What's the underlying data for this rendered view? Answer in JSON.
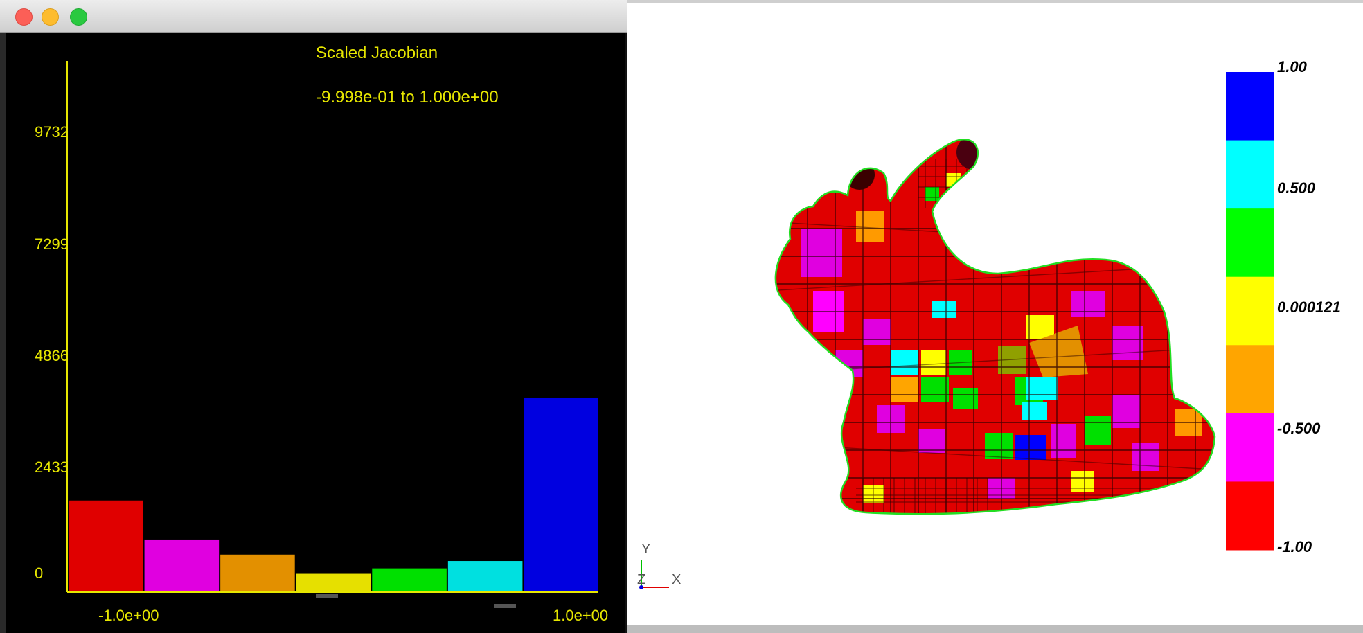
{
  "histogram_window": {
    "title_buttons": [
      "close",
      "minimize",
      "maximize"
    ]
  },
  "chart_data": {
    "type": "bar",
    "title": "Scaled Jacobian",
    "subtitle": "-9.998e-01 to 1.000e+00",
    "y_ticks": [
      "9732",
      "7299",
      "4866",
      "2433",
      "0"
    ],
    "x_ticks": [
      "-1.0e+00",
      "1.0e+00"
    ],
    "ylim": [
      0,
      11600
    ],
    "values": [
      2000,
      1150,
      820,
      400,
      520,
      680,
      4250
    ],
    "colors": [
      "#e00000",
      "#e000e0",
      "#e39000",
      "#e6e000",
      "#00e000",
      "#00e0e0",
      "#0000e0"
    ],
    "axis_color": "#e6e600"
  },
  "color_bar": {
    "labels": [
      "1.00",
      "0.500",
      "0.000121",
      "-0.500",
      "-1.00"
    ],
    "colors": [
      "#0000ff",
      "#00ffff",
      "#00ff00",
      "#ffff00",
      "#ffa500",
      "#ff00ff",
      "#ff0000"
    ]
  },
  "orientation_axes": {
    "y": "Y",
    "z": "Z",
    "x": "X"
  }
}
